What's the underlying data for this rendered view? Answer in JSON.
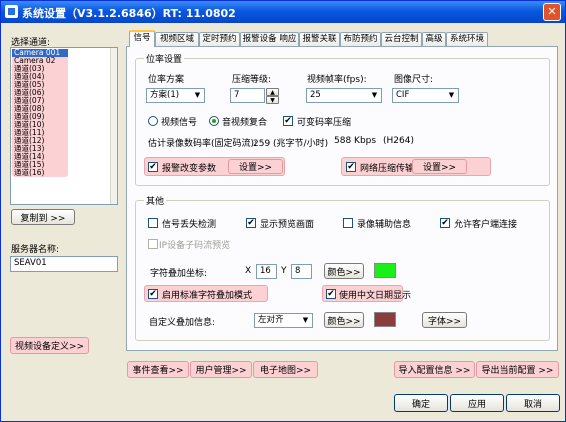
{
  "window": {
    "title": "系统设置（V3.1.2.6846）RT: 11.0802",
    "close_glyph": "✕"
  },
  "left": {
    "select_channel_label": "选择通道:",
    "channels": [
      "Camera 001",
      "Camera 02",
      "通道(03)",
      "通道(04)",
      "通道(05)",
      "通道(06)",
      "通道(07)",
      "通道(08)",
      "通道(09)",
      "通道(10)",
      "通道(11)",
      "通道(12)",
      "通道(13)",
      "通道(14)",
      "通道(15)",
      "通道(16)"
    ],
    "selected_index": 0,
    "copy_to_button": "复制到 >>",
    "server_name_label": "服务器名称:",
    "server_name_value": "SEAV01",
    "video_device_define_button": "视频设备定义>>"
  },
  "tabs": [
    "信号",
    "视频区域",
    "定时预约",
    "报警设备 响应",
    "报警关联",
    "布防预约",
    "云台控制",
    "高级",
    "系统环境"
  ],
  "active_tab": 0,
  "bitrate": {
    "group_title": "位率设置",
    "mode_label": "位率方案",
    "mode_value": "方案(1)",
    "compression_label": "压缩等级:",
    "compression_value": "7",
    "fps_label": "视频帧率(fps):",
    "fps_value": "25",
    "size_label": "图像尺寸:",
    "size_value": "CIF",
    "video_signal_label": "视频信号",
    "av_composite_label": "音视频复合",
    "vbr_label": "可变码率压缩",
    "vbr_checked": true,
    "estimate_label": "估计录像数码率(固定码流):",
    "estimate_value": "259 (兆字节/小时)",
    "estimate_kbps": "588 Kbps",
    "estimate_codec": "(H264)",
    "alarm_change_label": "报警改变参数",
    "alarm_change_checked": true,
    "alarm_setup_button": "设置>>",
    "net_transfer_label": "网络压缩传输",
    "net_transfer_checked": true,
    "net_setup_button": "设置>>"
  },
  "other": {
    "group_title": "其他",
    "signal_loss_label": "信号丢失检测",
    "signal_loss_checked": false,
    "show_preview_label": "显示预览画面",
    "show_preview_checked": true,
    "record_aux_label": "录像辅助信息",
    "record_aux_checked": false,
    "allow_client_label": "允许客户端连接",
    "allow_client_checked": true,
    "ip_device_label": "IP设备子码流预览",
    "ip_device_checked": false,
    "overlay_coord_label": "字符叠加坐标:",
    "x_label": "X",
    "x_value": "16",
    "y_label": "Y",
    "y_value": "8",
    "color_button_1": "颜色>>",
    "color_1": "#18f018",
    "std_overlay_label": "启用标准字符叠加模式",
    "std_overlay_checked": true,
    "cn_date_label": "使用中文日期显示",
    "cn_date_checked": true,
    "custom_overlay_label": "自定义叠加信息:",
    "align_value": "左对齐",
    "color_button_2": "颜色>>",
    "color_2": "#8b3c3c",
    "font_button": "字体>>"
  },
  "bottom_left_buttons": [
    "事件查看>>",
    "用户管理>>",
    "电子地图>>"
  ],
  "bottom_right_buttons": [
    "导入配置信息 >>",
    "导出当前配置 >>"
  ],
  "dialog_buttons": {
    "ok": "确定",
    "apply": "应用",
    "cancel": "取消"
  },
  "glyphs": {
    "dropdown": "▼",
    "spin_up": "▲",
    "spin_down": "▼",
    "check": "✔"
  }
}
